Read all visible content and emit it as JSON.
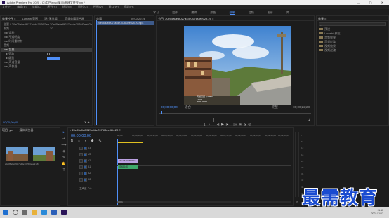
{
  "window": {
    "title": "Adobe Premiere Pro 2020 - C:\\用户\\rbsp\\桌面\\新建文件夹\\yin *",
    "controls": "— ▢ ✕"
  },
  "menu": [
    "文件(F)",
    "编辑(E)",
    "剪辑(C)",
    "序列(S)",
    "标记(M)",
    "图形(G)",
    "视图(V)",
    "窗口(W)",
    "帮助(H)"
  ],
  "workspaces": {
    "items": [
      "学习",
      "组件",
      "编辑",
      "颜色",
      "效果",
      "音频",
      "图形",
      "库"
    ],
    "active": "效果"
  },
  "effect_controls": {
    "tabs": [
      "效果控件 ≡",
      "Lumetri 范围",
      "源:(无剪辑)",
      "音频剪辑混合器"
    ],
    "master": "主要 * 20e05a0e8f027a4de7076f3ee…",
    "sequence": "20e05a0e8f027a4de7076f3ee02b-20…",
    "rows": [
      "视频",
      "fx ▸ 运动",
      "fx ▸ 不透明度",
      "fx ▸ 时间重映射",
      "音频",
      "fx ▸ 音量",
      "▸ 旁路",
      "▸ 级别",
      "fx ▸ 声道音量",
      "fx ▸ 声像器"
    ],
    "timecode": "00;00;00;00"
  },
  "clip_panel": {
    "label": "剪辑",
    "time": "00;00;22;28",
    "clip": "20e05a0e8f027a4de7076f3ee02b-20.mp4"
  },
  "program": {
    "title": "节目: 20e05a0e8f027a4de7076f3ee02b-20 ≡",
    "timecode_left": "00;00;00;00",
    "fit": "适合",
    "quality": "完整",
    "timecode_right": "00;00;22;28",
    "overlay_lines": [
      "海拔高度 2,385 ft",
      "12:01",
      "2021/11/27"
    ],
    "transport": [
      "{",
      "}",
      "|←",
      "◂|",
      "▶",
      "|▸",
      "→|",
      "⊟",
      "⊞",
      "⎘",
      "◎",
      "+"
    ]
  },
  "library": {
    "title": "效果 ≡",
    "search": "",
    "items": [
      "预设",
      "Lumetri 预设",
      "音频效果",
      "音频过渡",
      "视频效果",
      "视频过渡"
    ]
  },
  "project": {
    "tabs": [
      "项目: yin",
      "媒体浏览器"
    ],
    "items": [
      {
        "name": "20e05a0e8f027a4de7076f3ee…",
        "dur": "22;28"
      },
      {
        "name": "20e05a0e8f027a4de7076f3ee…",
        "dur": "22;28"
      }
    ]
  },
  "tools": [
    "▸",
    "⇥",
    "⟷",
    "◈",
    "✎",
    "✋",
    "T"
  ],
  "timeline": {
    "title": "× 20e05a0e8f027a4de7076f3ee02b-20 ≡",
    "timecode": "00;00;00;00",
    "ruler": [
      "00;00",
      "00;00;16;00",
      "00;00;32;00",
      "00;00;48;00",
      "00;01;04;02",
      "00;01;20;02",
      "00;01;36;02",
      "00;01;52;02",
      "00;02;08;04",
      "00;02;24;04",
      "00;02;40;04",
      "00;02;56;04",
      "00;03;12;06"
    ],
    "tracks": [
      "V3",
      "V2",
      "V1",
      "A1",
      "A2",
      "A3"
    ],
    "master": "主声道",
    "master_val": "0.0",
    "video_clip": "20e05a0e8f027a",
    "audio_clip": "音频轨道",
    "accent": "#bba1e2"
  },
  "meters": {
    "scale": [
      "0",
      "-6",
      "-12",
      "-18",
      "-24",
      "-30",
      "-36",
      "-42",
      "-48",
      "-54"
    ],
    "db": "dB"
  },
  "taskbar": {
    "time": "11:10",
    "date": "2021/11/12"
  },
  "watermark": "最需教育"
}
